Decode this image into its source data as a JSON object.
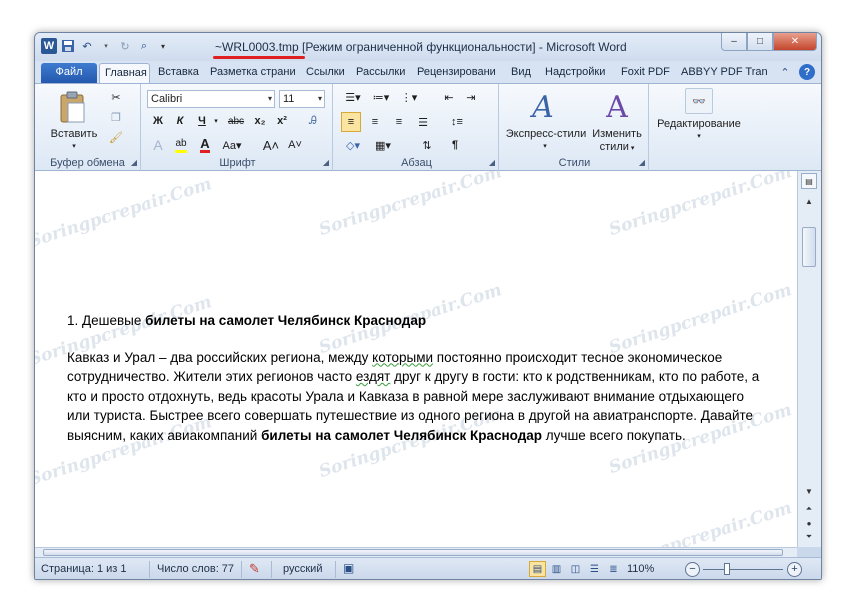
{
  "titlebar": {
    "title": "~WRL0003.tmp [Режим ограниченной функциональности]  -  Microsoft Word",
    "app_icon": "W",
    "minimize": "–",
    "maximize": "□",
    "close": "✕"
  },
  "tabs": [
    {
      "label": "Файл"
    },
    {
      "label": "Главная"
    },
    {
      "label": "Вставка"
    },
    {
      "label": "Разметка страни"
    },
    {
      "label": "Ссылки"
    },
    {
      "label": "Рассылки"
    },
    {
      "label": "Рецензировани"
    },
    {
      "label": "Вид"
    },
    {
      "label": "Надстройки"
    },
    {
      "label": "Foxit PDF"
    },
    {
      "label": "ABBYY PDF Trans"
    }
  ],
  "ribbon": {
    "clipboard": {
      "label": "Буфер обмена",
      "paste": "Вставить"
    },
    "font": {
      "label": "Шрифт",
      "font_name": "Calibri",
      "font_size": "11"
    },
    "paragraph": {
      "label": "Абзац"
    },
    "styles": {
      "label": "Стили",
      "express": "Экспресс-стили",
      "change1": "Изменить",
      "change2": "стили"
    },
    "editing": {
      "label": "Редактирование"
    }
  },
  "document": {
    "heading_prefix": "1. Дешевые ",
    "heading_bold": "билеты на самолет Челябинск Краснодар",
    "p1": "Кавказ и Урал – два российских региона, между ",
    "p2": "которыми",
    "p3": "  постоянно происходит  тесное экономическое  сотрудничество. Жители этих регионов часто ",
    "p4": "ездят",
    "p5": " друг к другу в гости: кто к родственникам, кто по работе, а кто и просто  отдохнуть, ведь красоты Урала и Кавказа в равной мере заслуживают внимание отдыхающего или туриста. Быстрее всего совершать путешествие из одного региона в другой на авиатранспорте. Давайте выясним, каких авиакомпаний ",
    "p6": "билеты на самолет Челябинск Краснодар",
    "p7": " лучше всего покупать."
  },
  "watermark": "Soringpcrepair.Com",
  "statusbar": {
    "page": "Страница: 1 из 1",
    "words": "Число слов: 77",
    "language": "русский",
    "zoom": "110%",
    "zoom_level_percent": 110
  }
}
